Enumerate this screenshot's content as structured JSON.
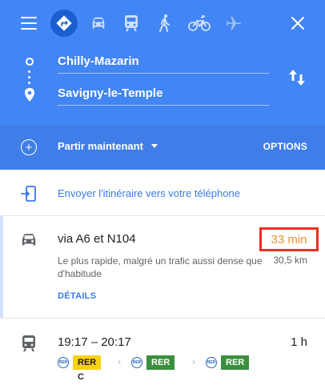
{
  "modes": [
    {
      "name": "best",
      "icon": "directions-icon",
      "active": true
    },
    {
      "name": "driving",
      "icon": "car-icon",
      "active": false
    },
    {
      "name": "transit",
      "icon": "train-icon",
      "active": false
    },
    {
      "name": "walking",
      "icon": "walk-icon",
      "active": false
    },
    {
      "name": "cycling",
      "icon": "bike-icon",
      "active": false
    },
    {
      "name": "flights",
      "icon": "airplane-icon",
      "active": false
    }
  ],
  "route": {
    "origin": "Chilly-Mazarin",
    "destination": "Savigny-le-Temple"
  },
  "options_bar": {
    "depart_label": "Partir maintenant",
    "options_label": "OPTIONS"
  },
  "send_to_phone": {
    "label": "Envoyer l'itinéraire vers votre téléphone"
  },
  "driving_route": {
    "title": "via A6 et N104",
    "duration": "33 min",
    "description": "Le plus rapide, malgré un trafic aussi dense que d'habitude",
    "distance": "30,5 km",
    "details_label": "DÉTAILS"
  },
  "transit_route": {
    "time_range": "19:17 – 20:17",
    "duration": "1 h",
    "legs": [
      {
        "logo": "RER",
        "line": "RER C",
        "bg": "#f7d117",
        "fg": "#212121"
      },
      {
        "logo": "RER",
        "line": "RER D",
        "bg": "#3b8f3e",
        "fg": "#ffffff"
      },
      {
        "logo": "RER",
        "line": "RER D",
        "bg": "#3b8f3e",
        "fg": "#ffffff"
      }
    ]
  },
  "colors": {
    "primary_blue": "#4285f4",
    "options_blue": "#3f7ee9",
    "link_blue": "#3b78e7",
    "duration_orange": "#e8912c",
    "highlight_red": "#e53222"
  }
}
